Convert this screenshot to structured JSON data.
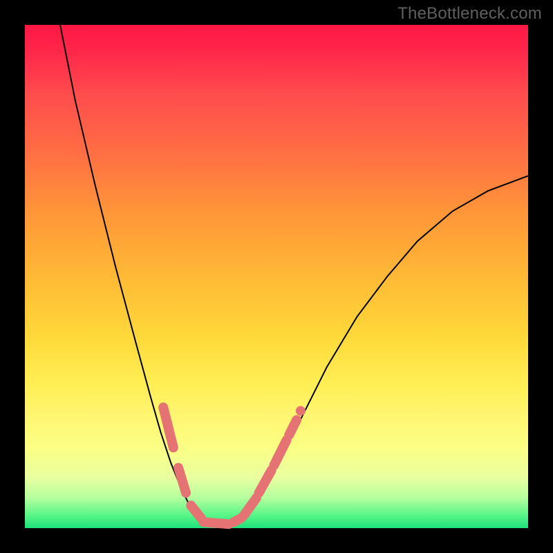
{
  "watermark": "TheBottleneck.com",
  "colors": {
    "background": "#000000",
    "gradient_top": "#ff1744",
    "gradient_mid": "#ffd93a",
    "gradient_bottom": "#1ee27a",
    "curve": "#000000",
    "marker": "#e57373"
  },
  "chart_data": {
    "type": "line",
    "title": "",
    "xlabel": "",
    "ylabel": "",
    "xlim": [
      0,
      100
    ],
    "ylim": [
      0,
      100
    ],
    "series": [
      {
        "name": "bottleneck-curve",
        "x": [
          7,
          10,
          14,
          18,
          22,
          25,
          27,
          29,
          31,
          33,
          35,
          37,
          40,
          43,
          46,
          50,
          55,
          60,
          66,
          72,
          78,
          85,
          92,
          100
        ],
        "y": [
          100,
          85,
          68,
          52,
          37,
          26,
          19,
          13,
          8,
          4,
          1.5,
          0.5,
          0.5,
          2,
          6,
          12,
          22,
          32,
          42,
          50,
          57,
          63,
          67,
          70
        ]
      }
    ],
    "annotations": {
      "marker_segments_left": [
        {
          "x1": 27.5,
          "y1": 24,
          "x2": 29.5,
          "y2": 16
        },
        {
          "x1": 30.5,
          "y1": 12,
          "x2": 32.0,
          "y2": 7
        },
        {
          "x1": 33.0,
          "y1": 4.5,
          "x2": 35.0,
          "y2": 2
        }
      ],
      "marker_segments_bottom": [
        {
          "x1": 35.5,
          "y1": 1.2,
          "x2": 40.5,
          "y2": 0.8
        },
        {
          "x1": 41.5,
          "y1": 1.2,
          "x2": 43.0,
          "y2": 2.0
        }
      ],
      "marker_segments_right": [
        {
          "x1": 43.5,
          "y1": 2.5,
          "x2": 46.0,
          "y2": 6.0
        },
        {
          "x1": 46.5,
          "y1": 7.0,
          "x2": 49.0,
          "y2": 11.5
        },
        {
          "x1": 49.5,
          "y1": 12.5,
          "x2": 52.0,
          "y2": 17.5
        },
        {
          "x1": 52.5,
          "y1": 18.5,
          "x2": 54.0,
          "y2": 21.5
        }
      ],
      "marker_dot_right": {
        "x": 54.8,
        "y": 23.3
      }
    }
  }
}
